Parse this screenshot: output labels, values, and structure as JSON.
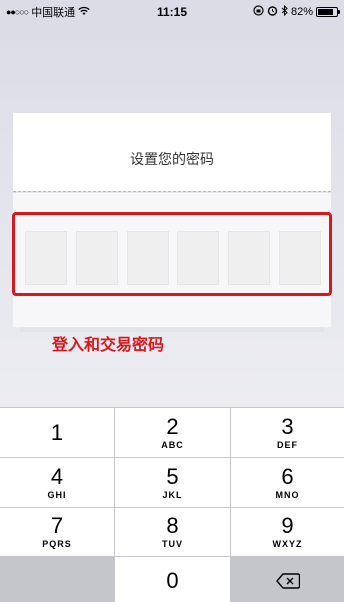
{
  "status_bar": {
    "signal_dots": "●●○○○",
    "carrier": "中国联通",
    "time": "11:15",
    "battery_percent_text": "82%",
    "battery_level": 0.82,
    "wifi_icon": "wifi-icon",
    "lock_rotation_icon": "rotation-lock-icon",
    "alarm_icon": "alarm-icon",
    "bluetooth_icon": "bluetooth-icon"
  },
  "dialog": {
    "title": "设置您的密码",
    "pin_length": 6
  },
  "annotation": {
    "text": "登入和交易密码",
    "color": "#d4181c"
  },
  "keypad": {
    "keys": [
      {
        "num": "1",
        "letters": ""
      },
      {
        "num": "2",
        "letters": "ABC"
      },
      {
        "num": "3",
        "letters": "DEF"
      },
      {
        "num": "4",
        "letters": "GHI"
      },
      {
        "num": "5",
        "letters": "JKL"
      },
      {
        "num": "6",
        "letters": "MNO"
      },
      {
        "num": "7",
        "letters": "PQRS"
      },
      {
        "num": "8",
        "letters": "TUV"
      },
      {
        "num": "9",
        "letters": "WXYZ"
      },
      {
        "num": "0",
        "letters": ""
      }
    ],
    "delete_icon": "backspace-icon"
  }
}
